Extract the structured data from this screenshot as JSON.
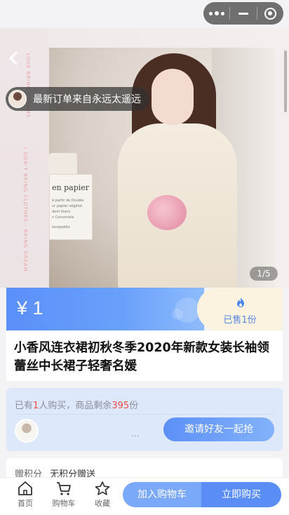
{
  "hero": {
    "page_indicator": "1/5",
    "book_title": "en papier",
    "book_lines": [
      "à partir de Double",
      "ur papier végétal",
      "dont blanc",
      "n Conomiste",
      "lecopabile"
    ],
    "side_text": "LOVE BRING DREAMS",
    "side_text_2": "I DON'T BRING CLOTHES · BRING DREAM"
  },
  "order_ticker": {
    "text": "最新订单来自永远太遥远"
  },
  "price": {
    "amount": "¥ 1",
    "sold_text": "已售1份"
  },
  "product": {
    "title": "小香风连衣裙初秋冬季2020年新款女装长袖领蕾丝中长裙子轻奢名媛"
  },
  "group_buy": {
    "prefix": "已有",
    "count": "1",
    "middle": "人购买，商品剩余",
    "remaining": "395",
    "suffix": "份",
    "ellipsis": "...",
    "invite_label": "邀请好友一起抢"
  },
  "points": {
    "label": "赠积分",
    "value": "无积分赠送"
  },
  "bottom_nav": {
    "home": "首页",
    "cart": "购物车",
    "favorite": "收藏",
    "add_to_cart": "加入购物车",
    "buy_now": "立即购买"
  },
  "colors": {
    "accent": "#5b8ff9",
    "sold_bg": "#fbf3df",
    "highlight_red": "#f04a4a"
  }
}
